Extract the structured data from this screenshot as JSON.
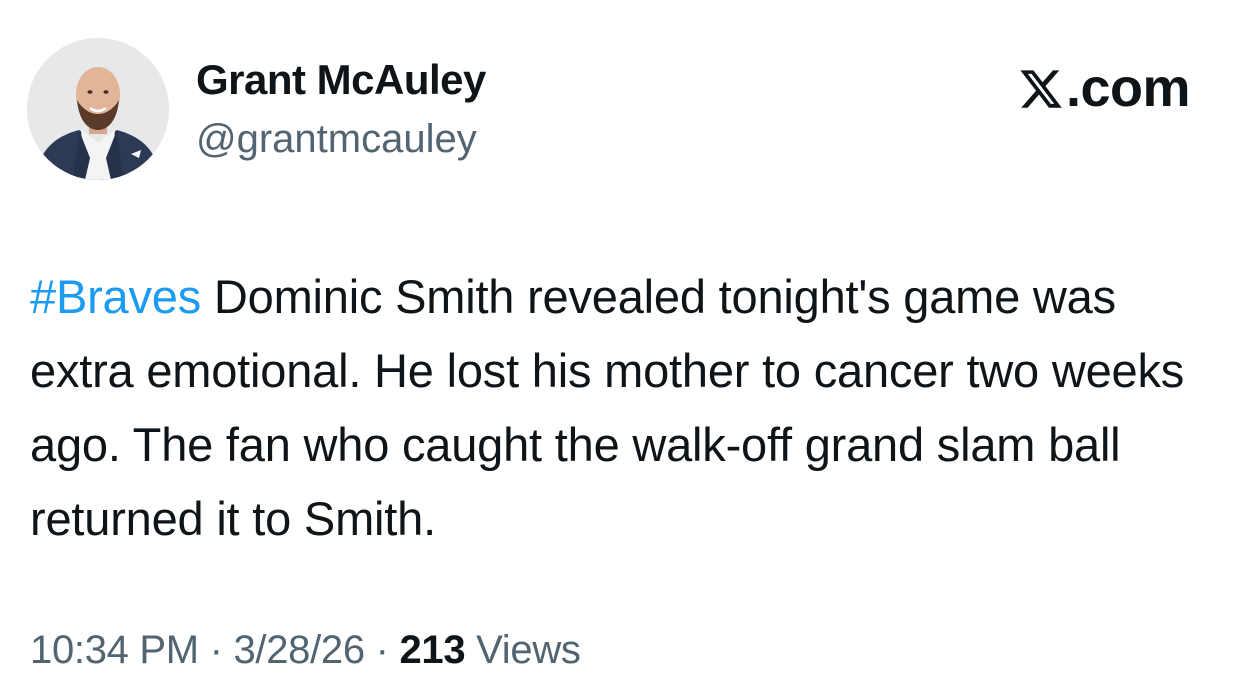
{
  "author": {
    "display_name": "Grant McAuley",
    "handle": "@grantmcauley"
  },
  "brand": {
    "label": ".com",
    "icon": "x-logo-icon"
  },
  "tweet": {
    "hashtag": "#Braves",
    "body": " Dominic Smith revealed tonight's game was extra emotional. He lost his mother to cancer two weeks ago. The fan who caught the walk-off grand slam ball returned it to Smith."
  },
  "meta": {
    "time": "10:34 PM",
    "separator": " · ",
    "date": "3/28/26",
    "views_count": "213",
    "views_label": " Views"
  },
  "colors": {
    "text": "#0f1419",
    "secondary": "#536471",
    "link": "#1d9bf0"
  }
}
